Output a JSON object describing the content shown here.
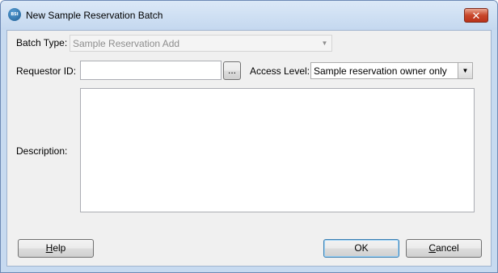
{
  "window": {
    "title": "New Sample Reservation Batch",
    "close_glyph": "✕",
    "app_icon_text": "BSI"
  },
  "form": {
    "batch_type_label": "Batch Type:",
    "batch_type_value": "Sample Reservation Add",
    "requestor_label": "Requestor ID:",
    "requestor_value": "",
    "browse_label": "...",
    "access_level_label": "Access Level:",
    "access_level_value": "Sample reservation owner only",
    "description_label": "Description:",
    "description_value": ""
  },
  "buttons": {
    "help": "Help",
    "ok": "OK",
    "cancel": "Cancel"
  }
}
